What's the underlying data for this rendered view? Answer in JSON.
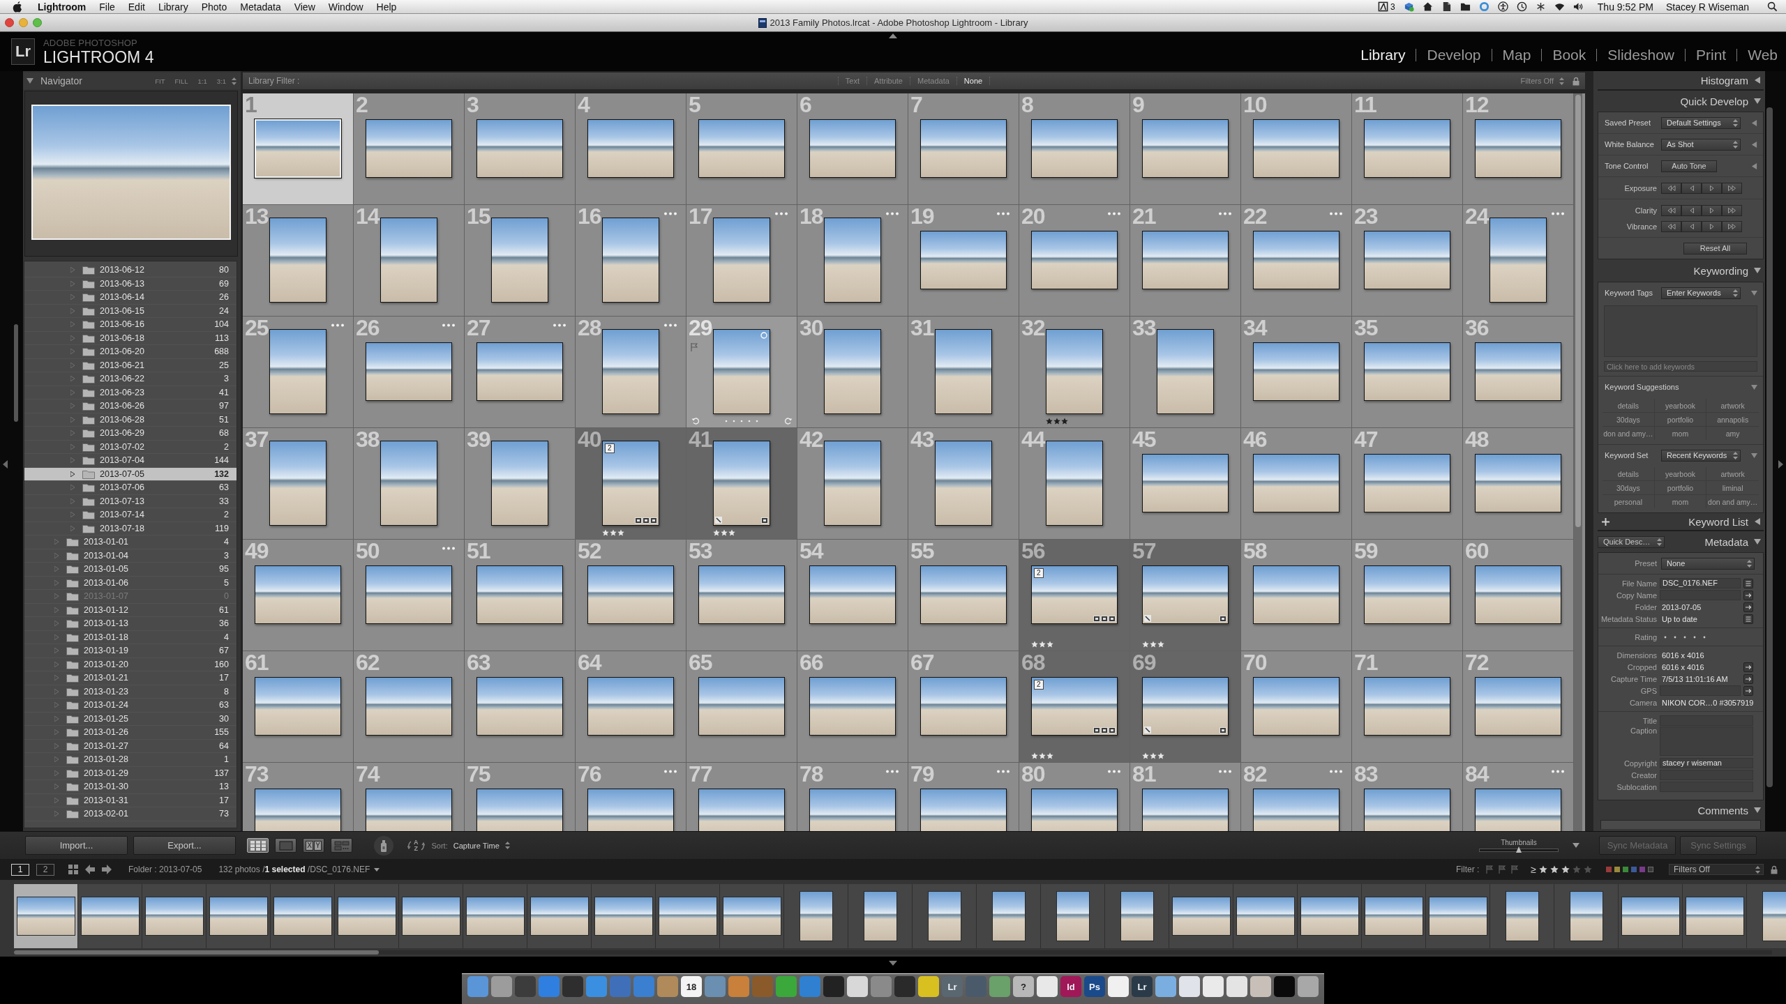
{
  "menu_bar": {
    "app_name": "Lightroom",
    "menus": [
      "File",
      "Edit",
      "Library",
      "Photo",
      "Metadata",
      "View",
      "Window",
      "Help"
    ],
    "badge": "3",
    "clock": "Thu 9:52 PM",
    "user": "Stacey R Wiseman"
  },
  "window": {
    "title": "2013 Family Photos.lrcat - Adobe Photoshop Lightroom - Library"
  },
  "identity_plate": {
    "logo": "Lr",
    "brand": "ADOBE PHOTOSHOP",
    "product": "LIGHTROOM 4"
  },
  "modules": [
    {
      "label": "Library",
      "selected": true
    },
    {
      "label": "Develop",
      "selected": false
    },
    {
      "label": "Map",
      "selected": false
    },
    {
      "label": "Book",
      "selected": false
    },
    {
      "label": "Slideshow",
      "selected": false
    },
    {
      "label": "Print",
      "selected": false
    },
    {
      "label": "Web",
      "selected": false
    }
  ],
  "left_panel": {
    "navigator": {
      "title": "Navigator",
      "expanded": true,
      "zoom_levels": [
        {
          "label": "FIT",
          "selected": false
        },
        {
          "label": "FILL",
          "selected": false
        },
        {
          "label": "1:1",
          "selected": false
        },
        {
          "label": "3:1",
          "selected": false
        }
      ]
    },
    "folders": [
      {
        "children": [
          {
            "name": "2013-06-12",
            "count": "80",
            "selected": false,
            "disabled": false
          },
          {
            "name": "2013-06-13",
            "count": "69",
            "selected": false,
            "disabled": false
          },
          {
            "name": "2013-06-14",
            "count": "26",
            "selected": false,
            "disabled": false
          },
          {
            "name": "2013-06-15",
            "count": "24",
            "selected": false,
            "disabled": false
          },
          {
            "name": "2013-06-16",
            "count": "104",
            "selected": false,
            "disabled": false
          },
          {
            "name": "2013-06-18",
            "count": "113",
            "selected": false,
            "disabled": false
          },
          {
            "name": "2013-06-20",
            "count": "688",
            "selected": false,
            "disabled": false
          },
          {
            "name": "2013-06-21",
            "count": "25",
            "selected": false,
            "disabled": false
          },
          {
            "name": "2013-06-22",
            "count": "3",
            "selected": false,
            "disabled": false
          },
          {
            "name": "2013-06-23",
            "count": "41",
            "selected": false,
            "disabled": false
          },
          {
            "name": "2013-06-26",
            "count": "97",
            "selected": false,
            "disabled": false
          },
          {
            "name": "2013-06-28",
            "count": "51",
            "selected": false,
            "disabled": false
          },
          {
            "name": "2013-06-29",
            "count": "68",
            "selected": false,
            "disabled": false
          },
          {
            "name": "2013-07-02",
            "count": "2",
            "selected": false,
            "disabled": false
          },
          {
            "name": "2013-07-04",
            "count": "144",
            "selected": false,
            "disabled": false
          },
          {
            "name": "2013-07-05",
            "count": "132",
            "selected": true,
            "disabled": false
          },
          {
            "name": "2013-07-06",
            "count": "63",
            "selected": false,
            "disabled": false
          },
          {
            "name": "2013-07-13",
            "count": "33",
            "selected": false,
            "disabled": false
          },
          {
            "name": "2013-07-14",
            "count": "2",
            "selected": false,
            "disabled": false
          },
          {
            "name": "2013-07-18",
            "count": "119",
            "selected": false,
            "disabled": false
          }
        ]
      },
      {
        "name": "2013-01-01",
        "count": "4",
        "selected": false,
        "disabled": false
      },
      {
        "name": "2013-01-04",
        "count": "3",
        "selected": false,
        "disabled": false
      },
      {
        "name": "2013-01-05",
        "count": "95",
        "selected": false,
        "disabled": false
      },
      {
        "name": "2013-01-06",
        "count": "5",
        "selected": false,
        "disabled": false
      },
      {
        "name": "2013-01-07",
        "count": "0",
        "selected": false,
        "disabled": true
      },
      {
        "name": "2013-01-12",
        "count": "61",
        "selected": false,
        "disabled": false
      },
      {
        "name": "2013-01-13",
        "count": "36",
        "selected": false,
        "disabled": false
      },
      {
        "name": "2013-01-18",
        "count": "4",
        "selected": false,
        "disabled": false
      },
      {
        "name": "2013-01-19",
        "count": "67",
        "selected": false,
        "disabled": false
      },
      {
        "name": "2013-01-20",
        "count": "160",
        "selected": false,
        "disabled": false
      },
      {
        "name": "2013-01-21",
        "count": "17",
        "selected": false,
        "disabled": false
      },
      {
        "name": "2013-01-23",
        "count": "8",
        "selected": false,
        "disabled": false
      },
      {
        "name": "2013-01-24",
        "count": "63",
        "selected": false,
        "disabled": false
      },
      {
        "name": "2013-01-25",
        "count": "30",
        "selected": false,
        "disabled": false
      },
      {
        "name": "2013-01-26",
        "count": "155",
        "selected": false,
        "disabled": false
      },
      {
        "name": "2013-01-27",
        "count": "64",
        "selected": false,
        "disabled": false
      },
      {
        "name": "2013-01-28",
        "count": "1",
        "selected": false,
        "disabled": false
      },
      {
        "name": "2013-01-29",
        "count": "137",
        "selected": false,
        "disabled": false
      },
      {
        "name": "2013-01-30",
        "count": "13",
        "selected": false,
        "disabled": false
      },
      {
        "name": "2013-01-31",
        "count": "17",
        "selected": false,
        "disabled": false
      },
      {
        "name": "2013-02-01",
        "count": "73",
        "selected": false,
        "disabled": false
      }
    ],
    "buttons": [
      "Import...",
      "Export..."
    ]
  },
  "library_filter": {
    "label": "Library Filter :",
    "options": [
      {
        "label": "Text",
        "selected": false
      },
      {
        "label": "Attribute",
        "selected": false
      },
      {
        "label": "Metadata",
        "selected": false
      },
      {
        "label": "None",
        "selected": true
      }
    ],
    "status": "Filters Off"
  },
  "grid": {
    "cells": [
      {
        "number": "1",
        "kind": "landscape",
        "selected": true,
        "hovered": false,
        "grouped": false,
        "dots": false
      },
      {
        "number": "2",
        "kind": "landscape",
        "selected": false,
        "hovered": false,
        "grouped": false,
        "dots": false
      },
      {
        "number": "3",
        "kind": "landscape",
        "selected": false,
        "hovered": false,
        "grouped": false,
        "dots": false
      },
      {
        "number": "4",
        "kind": "landscape",
        "selected": false,
        "hovered": false,
        "grouped": false,
        "dots": false
      },
      {
        "number": "5",
        "kind": "landscape",
        "selected": false,
        "hovered": false,
        "grouped": false,
        "dots": false
      },
      {
        "number": "6",
        "kind": "landscape",
        "selected": false,
        "hovered": false,
        "grouped": false,
        "dots": false
      },
      {
        "number": "7",
        "kind": "landscape",
        "selected": false,
        "hovered": false,
        "grouped": false,
        "dots": false
      },
      {
        "number": "8",
        "kind": "landscape",
        "selected": false,
        "hovered": false,
        "grouped": false,
        "dots": false
      },
      {
        "number": "9",
        "kind": "landscape",
        "selected": false,
        "hovered": false,
        "grouped": false,
        "dots": false
      },
      {
        "number": "10",
        "kind": "landscape",
        "selected": false,
        "hovered": false,
        "grouped": false,
        "dots": false
      },
      {
        "number": "11",
        "kind": "landscape",
        "selected": false,
        "hovered": false,
        "grouped": false,
        "dots": false
      },
      {
        "number": "12",
        "kind": "landscape",
        "selected": false,
        "hovered": false,
        "grouped": false,
        "dots": false
      },
      {
        "number": "13",
        "kind": "portrait",
        "selected": false,
        "hovered": false,
        "grouped": false,
        "dots": false
      },
      {
        "number": "14",
        "kind": "portrait",
        "selected": false,
        "hovered": false,
        "grouped": false,
        "dots": false
      },
      {
        "number": "15",
        "kind": "portrait",
        "selected": false,
        "hovered": false,
        "grouped": false,
        "dots": false
      },
      {
        "number": "16",
        "kind": "portrait",
        "selected": false,
        "hovered": false,
        "grouped": false,
        "dots": true
      },
      {
        "number": "17",
        "kind": "portrait",
        "selected": false,
        "hovered": false,
        "grouped": false,
        "dots": true
      },
      {
        "number": "18",
        "kind": "portrait",
        "selected": false,
        "hovered": false,
        "grouped": false,
        "dots": true
      },
      {
        "number": "19",
        "kind": "landscape",
        "selected": false,
        "hovered": false,
        "grouped": false,
        "dots": true
      },
      {
        "number": "20",
        "kind": "landscape",
        "selected": false,
        "hovered": false,
        "grouped": false,
        "dots": true
      },
      {
        "number": "21",
        "kind": "landscape",
        "selected": false,
        "hovered": false,
        "grouped": false,
        "dots": true
      },
      {
        "number": "22",
        "kind": "landscape",
        "selected": false,
        "hovered": false,
        "grouped": false,
        "dots": true
      },
      {
        "number": "23",
        "kind": "landscape",
        "selected": false,
        "hovered": false,
        "grouped": false,
        "dots": false
      },
      {
        "number": "24",
        "kind": "portrait",
        "selected": false,
        "hovered": false,
        "grouped": false,
        "dots": true
      },
      {
        "number": "25",
        "kind": "portrait",
        "selected": false,
        "hovered": false,
        "grouped": false,
        "dots": true
      },
      {
        "number": "26",
        "kind": "landscape",
        "selected": false,
        "hovered": false,
        "grouped": false,
        "dots": true
      },
      {
        "number": "27",
        "kind": "landscape",
        "selected": false,
        "hovered": false,
        "grouped": false,
        "dots": true
      },
      {
        "number": "28",
        "kind": "portrait",
        "selected": false,
        "hovered": false,
        "grouped": false,
        "dots": true
      },
      {
        "number": "29",
        "kind": "portrait",
        "selected": false,
        "hovered": true,
        "grouped": false,
        "dots": false
      },
      {
        "number": "30",
        "kind": "portrait",
        "selected": false,
        "hovered": false,
        "grouped": false,
        "dots": false
      },
      {
        "number": "31",
        "kind": "portrait",
        "selected": false,
        "hovered": false,
        "grouped": false,
        "dots": false
      },
      {
        "number": "32",
        "kind": "portrait",
        "selected": false,
        "hovered": false,
        "grouped": false,
        "dots": false,
        "stars": 3
      },
      {
        "number": "33",
        "kind": "portrait",
        "selected": false,
        "hovered": false,
        "grouped": false,
        "dots": false
      },
      {
        "number": "34",
        "kind": "landscape",
        "selected": false,
        "hovered": false,
        "grouped": false,
        "dots": false
      },
      {
        "number": "35",
        "kind": "landscape",
        "selected": false,
        "hovered": false,
        "grouped": false,
        "dots": false
      },
      {
        "number": "36",
        "kind": "landscape",
        "selected": false,
        "hovered": false,
        "grouped": false,
        "dots": false
      },
      {
        "number": "37",
        "kind": "portrait",
        "selected": false,
        "hovered": false,
        "grouped": false,
        "dots": false
      },
      {
        "number": "38",
        "kind": "portrait",
        "selected": false,
        "hovered": false,
        "grouped": false,
        "dots": false
      },
      {
        "number": "39",
        "kind": "portrait",
        "selected": false,
        "hovered": false,
        "grouped": false,
        "dots": false
      },
      {
        "number": "40",
        "kind": "portrait",
        "selected": false,
        "hovered": false,
        "grouped": true,
        "dots": false,
        "stars": 3,
        "stack_count": "2"
      },
      {
        "number": "41",
        "kind": "portrait",
        "selected": false,
        "hovered": false,
        "grouped": true,
        "dots": false,
        "stars": 3
      },
      {
        "number": "42",
        "kind": "portrait",
        "selected": false,
        "hovered": false,
        "grouped": false,
        "dots": false
      },
      {
        "number": "43",
        "kind": "portrait",
        "selected": false,
        "hovered": false,
        "grouped": false,
        "dots": false
      },
      {
        "number": "44",
        "kind": "portrait",
        "selected": false,
        "hovered": false,
        "grouped": false,
        "dots": false
      },
      {
        "number": "45",
        "kind": "landscape",
        "selected": false,
        "hovered": false,
        "grouped": false,
        "dots": false
      },
      {
        "number": "46",
        "kind": "landscape",
        "selected": false,
        "hovered": false,
        "grouped": false,
        "dots": false
      },
      {
        "number": "47",
        "kind": "landscape",
        "selected": false,
        "hovered": false,
        "grouped": false,
        "dots": false
      },
      {
        "number": "48",
        "kind": "landscape",
        "selected": false,
        "hovered": false,
        "grouped": false,
        "dots": false
      },
      {
        "number": "49",
        "kind": "landscape",
        "selected": false,
        "hovered": false,
        "grouped": false,
        "dots": false
      },
      {
        "number": "50",
        "kind": "landscape",
        "selected": false,
        "hovered": false,
        "grouped": false,
        "dots": true
      },
      {
        "number": "51",
        "kind": "landscape",
        "selected": false,
        "hovered": false,
        "grouped": false,
        "dots": false
      },
      {
        "number": "52",
        "kind": "landscape",
        "selected": false,
        "hovered": false,
        "grouped": false,
        "dots": false
      },
      {
        "number": "53",
        "kind": "landscape",
        "selected": false,
        "hovered": false,
        "grouped": false,
        "dots": false
      },
      {
        "number": "54",
        "kind": "landscape",
        "selected": false,
        "hovered": false,
        "grouped": false,
        "dots": false
      },
      {
        "number": "55",
        "kind": "landscape",
        "selected": false,
        "hovered": false,
        "grouped": false,
        "dots": false
      },
      {
        "number": "56",
        "kind": "landscape",
        "selected": false,
        "hovered": false,
        "grouped": true,
        "dots": false,
        "stars": 3,
        "stack_count": "2"
      },
      {
        "number": "57",
        "kind": "landscape",
        "selected": false,
        "hovered": false,
        "grouped": true,
        "dots": false,
        "stars": 3
      },
      {
        "number": "58",
        "kind": "landscape",
        "selected": false,
        "hovered": false,
        "grouped": false,
        "dots": false
      },
      {
        "number": "59",
        "kind": "landscape",
        "selected": false,
        "hovered": false,
        "grouped": false,
        "dots": false
      },
      {
        "number": "60",
        "kind": "landscape",
        "selected": false,
        "hovered": false,
        "grouped": false,
        "dots": false
      },
      {
        "number": "61",
        "kind": "landscape",
        "selected": false,
        "hovered": false,
        "grouped": false,
        "dots": false
      },
      {
        "number": "62",
        "kind": "landscape",
        "selected": false,
        "hovered": false,
        "grouped": false,
        "dots": false
      },
      {
        "number": "63",
        "kind": "landscape",
        "selected": false,
        "hovered": false,
        "grouped": false,
        "dots": false
      },
      {
        "number": "64",
        "kind": "landscape",
        "selected": false,
        "hovered": false,
        "grouped": false,
        "dots": false
      },
      {
        "number": "65",
        "kind": "landscape",
        "selected": false,
        "hovered": false,
        "grouped": false,
        "dots": false
      },
      {
        "number": "66",
        "kind": "landscape",
        "selected": false,
        "hovered": false,
        "grouped": false,
        "dots": false
      },
      {
        "number": "67",
        "kind": "landscape",
        "selected": false,
        "hovered": false,
        "grouped": false,
        "dots": false
      },
      {
        "number": "68",
        "kind": "landscape",
        "selected": false,
        "hovered": false,
        "grouped": true,
        "dots": false,
        "stars": 3,
        "stack_count": "2"
      },
      {
        "number": "69",
        "kind": "landscape",
        "selected": false,
        "hovered": false,
        "grouped": true,
        "dots": false,
        "stars": 3
      },
      {
        "number": "70",
        "kind": "landscape",
        "selected": false,
        "hovered": false,
        "grouped": false,
        "dots": false
      },
      {
        "number": "71",
        "kind": "landscape",
        "selected": false,
        "hovered": false,
        "grouped": false,
        "dots": false
      },
      {
        "number": "72",
        "kind": "landscape",
        "selected": false,
        "hovered": false,
        "grouped": false,
        "dots": false
      },
      {
        "number": "73",
        "kind": "landscape",
        "selected": false,
        "hovered": false,
        "grouped": false,
        "dots": false
      },
      {
        "number": "74",
        "kind": "landscape",
        "selected": false,
        "hovered": false,
        "grouped": false,
        "dots": false
      },
      {
        "number": "75",
        "kind": "landscape",
        "selected": false,
        "hovered": false,
        "grouped": false,
        "dots": false
      },
      {
        "number": "76",
        "kind": "landscape",
        "selected": false,
        "hovered": false,
        "grouped": false,
        "dots": true
      },
      {
        "number": "77",
        "kind": "landscape",
        "selected": false,
        "hovered": false,
        "grouped": false,
        "dots": false
      },
      {
        "number": "78",
        "kind": "landscape",
        "selected": false,
        "hovered": false,
        "grouped": false,
        "dots": true
      },
      {
        "number": "79",
        "kind": "landscape",
        "selected": false,
        "hovered": false,
        "grouped": false,
        "dots": true
      },
      {
        "number": "80",
        "kind": "landscape",
        "selected": false,
        "hovered": false,
        "grouped": false,
        "dots": true
      },
      {
        "number": "81",
        "kind": "landscape",
        "selected": false,
        "hovered": false,
        "grouped": false,
        "dots": true
      },
      {
        "number": "82",
        "kind": "landscape",
        "selected": false,
        "hovered": false,
        "grouped": false,
        "dots": true
      },
      {
        "number": "83",
        "kind": "landscape",
        "selected": false,
        "hovered": false,
        "grouped": false,
        "dots": false
      },
      {
        "number": "84",
        "kind": "landscape",
        "selected": false,
        "hovered": false,
        "grouped": false,
        "dots": true
      }
    ]
  },
  "right_panel": {
    "histogram": {
      "title": "Histogram",
      "expanded": false
    },
    "quick_develop": {
      "title": "Quick Develop",
      "expanded": true,
      "rows": [
        {
          "label": "Saved Preset",
          "kind": "dropdown",
          "value": "Default Settings",
          "expanded": false
        },
        {
          "label": "White Balance",
          "kind": "dropdown",
          "value": "As Shot",
          "expanded": false
        },
        {
          "label": "Tone Control",
          "kind": "button",
          "value": "Auto Tone",
          "expanded": false
        }
      ],
      "adjustment_groups": [
        [
          "Exposure"
        ],
        [
          "Clarity",
          "Vibrance"
        ]
      ],
      "reset": "Reset All"
    },
    "keywording": {
      "title": "Keywording",
      "expanded": true,
      "tags": {
        "label": "Keyword Tags",
        "value": "Enter Keywords",
        "expanded": true
      },
      "placeholder": "Click here to add keywords",
      "suggestions": {
        "title": "Keyword Suggestions",
        "expanded": true,
        "keywords": [
          "details",
          "yearbook",
          "artwork",
          "30days",
          "portfolio",
          "annapolis",
          "don and amy…",
          "mom",
          "amy"
        ]
      },
      "keyword_set": {
        "label": "Keyword Set",
        "value": "Recent Keywords",
        "expanded": true,
        "keywords": [
          "details",
          "yearbook",
          "artwork",
          "30days",
          "portfolio",
          "liminal",
          "personal",
          "mom",
          "don and amy…"
        ]
      }
    },
    "keyword_list": {
      "title": "Keyword List",
      "expanded": false
    },
    "metadata": {
      "title": "Metadata",
      "expanded": true,
      "view": "Quick Desc…",
      "preset_label": "Preset",
      "preset": "None",
      "groups": [
        [
          {
            "label": "File Name",
            "kind": "field",
            "value": "DSC_0176.NEF",
            "action": {
              "kind": "list"
            }
          },
          {
            "label": "Copy Name",
            "kind": "field",
            "action": {
              "kind": "go"
            }
          },
          {
            "label": "Folder",
            "kind": "text",
            "value": "2013-07-05",
            "action": {
              "kind": "go"
            }
          },
          {
            "label": "Metadata Status",
            "kind": "text",
            "value": "Up to date",
            "action": {
              "kind": "list"
            }
          }
        ],
        [
          {
            "label": "Rating",
            "kind": "rating"
          }
        ],
        [
          {
            "label": "Dimensions",
            "kind": "text",
            "value": "6016 x 4016"
          },
          {
            "label": "Cropped",
            "kind": "text",
            "value": "6016 x 4016",
            "action": {
              "kind": "go"
            }
          },
          {
            "label": "Capture Time",
            "kind": "text",
            "value": "7/5/13 11:01:16 AM",
            "action": {
              "kind": "go"
            }
          },
          {
            "label": "GPS",
            "kind": "field",
            "action": {
              "kind": "go"
            }
          },
          {
            "label": "Camera",
            "kind": "text",
            "value": "NIKON COR…0 #3057919"
          }
        ],
        [
          {
            "label": "Title",
            "kind": "field"
          },
          {
            "label": "Caption",
            "kind": "area"
          },
          {
            "label": "Copyright",
            "kind": "field",
            "value": "stacey r wiseman"
          },
          {
            "label": "Creator",
            "kind": "field"
          },
          {
            "label": "Sublocation",
            "kind": "field"
          }
        ]
      ]
    },
    "comments": {
      "title": "Comments",
      "expanded": true
    },
    "buttons": [
      {
        "label": "Sync Metadata",
        "disabled": true
      },
      {
        "label": "Sync Settings",
        "disabled": true
      }
    ]
  },
  "toolbar": {
    "view_modes": [
      {
        "kind": "grid",
        "selected": true
      },
      {
        "kind": "loupe",
        "selected": false
      },
      {
        "kind": "compare",
        "selected": false,
        "letters": [
          "X",
          "Y"
        ]
      },
      {
        "kind": "survey",
        "selected": false
      }
    ],
    "sort_direction": [
      "A",
      "Z"
    ],
    "sort_label": "Sort:",
    "sort_value": "Capture Time",
    "thumbnails_label": "Thumbnails",
    "thumbnail_size": {
      "level": 0.5
    }
  },
  "filmstrip_bar": {
    "screens": [
      {
        "label": "1",
        "selected": true
      },
      {
        "label": "2",
        "selected": false
      }
    ],
    "source": "Folder : 2013-07-05",
    "summary": "132 photos /**1 selected** /DSC_0176.NEF",
    "filter_label": "Filter :",
    "rating_operator": "≥",
    "rating_filter": {
      "stars": 3
    },
    "filters_status": "Filters Off"
  },
  "filmstrip": {
    "items": [
      {
        "kind": "landscape",
        "selected": true
      },
      {
        "kind": "landscape",
        "selected": false
      },
      {
        "kind": "landscape",
        "selected": false
      },
      {
        "kind": "landscape",
        "selected": false
      },
      {
        "kind": "landscape",
        "selected": false
      },
      {
        "kind": "landscape",
        "selected": false
      },
      {
        "kind": "landscape",
        "selected": false
      },
      {
        "kind": "landscape",
        "selected": false
      },
      {
        "kind": "landscape",
        "selected": false
      },
      {
        "kind": "landscape",
        "selected": false
      },
      {
        "kind": "landscape",
        "selected": false
      },
      {
        "kind": "landscape",
        "selected": false
      },
      {
        "kind": "portrait",
        "selected": false
      },
      {
        "kind": "portrait",
        "selected": false
      },
      {
        "kind": "portrait",
        "selected": false
      },
      {
        "kind": "portrait",
        "selected": false
      },
      {
        "kind": "portrait",
        "selected": false
      },
      {
        "kind": "portrait",
        "selected": false
      },
      {
        "kind": "landscape",
        "selected": false
      },
      {
        "kind": "landscape",
        "selected": false
      },
      {
        "kind": "landscape",
        "selected": false
      },
      {
        "kind": "landscape",
        "selected": false
      },
      {
        "kind": "landscape",
        "selected": false
      },
      {
        "kind": "portrait",
        "selected": false
      },
      {
        "kind": "portrait",
        "selected": false
      },
      {
        "kind": "landscape",
        "selected": false
      },
      {
        "kind": "landscape",
        "selected": false
      },
      {
        "kind": "portrait",
        "selected": false
      }
    ]
  },
  "dock": {
    "items": [
      {
        "color": "#5a95d8"
      },
      {
        "color": "#9c9c9c"
      },
      {
        "color": "#3c3c3c"
      },
      {
        "color": "#2f7fe0"
      },
      {
        "color": "#2e2e2e"
      },
      {
        "color": "#3a8fe0"
      },
      {
        "color": "#3f6fb8"
      },
      {
        "color": "#3a7fd0"
      },
      {
        "color": "#b08a5a"
      },
      {
        "color": "#f4f4f4",
        "label": "18"
      },
      {
        "color": "#6a8fb0"
      },
      {
        "color": "#c8803a"
      },
      {
        "color": "#8a5a2a"
      },
      {
        "color": "#3aa83a"
      },
      {
        "color": "#2f80d0"
      },
      {
        "color": "#222222"
      },
      {
        "color": "#d8d8d8"
      },
      {
        "color": "#8a8a8a"
      },
      {
        "color": "#2a2a2a"
      },
      {
        "color": "#d8c020"
      },
      {
        "color": "#5a6670",
        "label": "Lr"
      },
      {
        "color": "#4a5a6a"
      },
      {
        "color": "#6aa06a"
      },
      {
        "color": "#b8b8b8",
        "label": "?"
      },
      {
        "color": "#e8e8e8"
      },
      {
        "color": "#a01858",
        "label": "Id"
      },
      {
        "color": "#1a4a8a",
        "label": "Ps"
      },
      {
        "color": "#f0f0f0"
      },
      {
        "color": "#2a3a48",
        "label": "Lr"
      },
      {
        "color": "#7aaee0"
      },
      {
        "color": "#e0e4ea"
      },
      {
        "color": "#eaeaea"
      },
      {
        "color": "#e4e4e4"
      },
      {
        "color": "#c8c0b8"
      },
      {
        "color": "#0a0a0a"
      },
      {
        "color": "#a8a8a8"
      }
    ]
  }
}
